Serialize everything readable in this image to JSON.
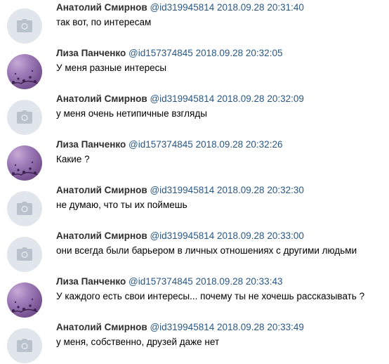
{
  "colors": {
    "author": "#2f2f2f",
    "meta_link": "#2a5885",
    "message_text": "#000000",
    "placeholder_bg": "#e1e6ec",
    "photo_avatar": "#9d7bb8"
  },
  "messages": [
    {
      "author": "Анатолий Смирнов",
      "user_id": "@id319945814",
      "datetime": "2018.09.28 20:31:40",
      "text": "так вот, по интересам",
      "avatar": "camera-placeholder-icon"
    },
    {
      "author": "Лиза Панченко",
      "user_id": "@id157374845",
      "datetime": "2018.09.28 20:32:05",
      "text": "У меня разные интересы",
      "avatar": "user-photo"
    },
    {
      "author": "Анатолий Смирнов",
      "user_id": "@id319945814",
      "datetime": "2018.09.28 20:32:09",
      "text": "у меня очень нетипичные взгляды",
      "avatar": "camera-placeholder-icon"
    },
    {
      "author": "Лиза Панченко",
      "user_id": "@id157374845",
      "datetime": "2018.09.28 20:32:26",
      "text": "Какие ?",
      "avatar": "user-photo"
    },
    {
      "author": "Анатолий Смирнов",
      "user_id": "@id319945814",
      "datetime": "2018.09.28 20:32:30",
      "text": "не думаю, что ты их поймешь",
      "avatar": "camera-placeholder-icon"
    },
    {
      "author": "Анатолий Смирнов",
      "user_id": "@id319945814",
      "datetime": "2018.09.28 20:33:00",
      "text": "они всегда были барьером в личных отношениях с другими людьми",
      "avatar": "camera-placeholder-icon"
    },
    {
      "author": "Лиза Панченко",
      "user_id": "@id157374845",
      "datetime": "2018.09.28 20:33:43",
      "text": "У каждого есть свои интересы... почему ты не хочешь рассказывать ?",
      "avatar": "user-photo"
    },
    {
      "author": "Анатолий Смирнов",
      "user_id": "@id319945814",
      "datetime": "2018.09.28 20:33:49",
      "text": "у меня, собственно, друзей даже нет",
      "avatar": "camera-placeholder-icon"
    }
  ]
}
